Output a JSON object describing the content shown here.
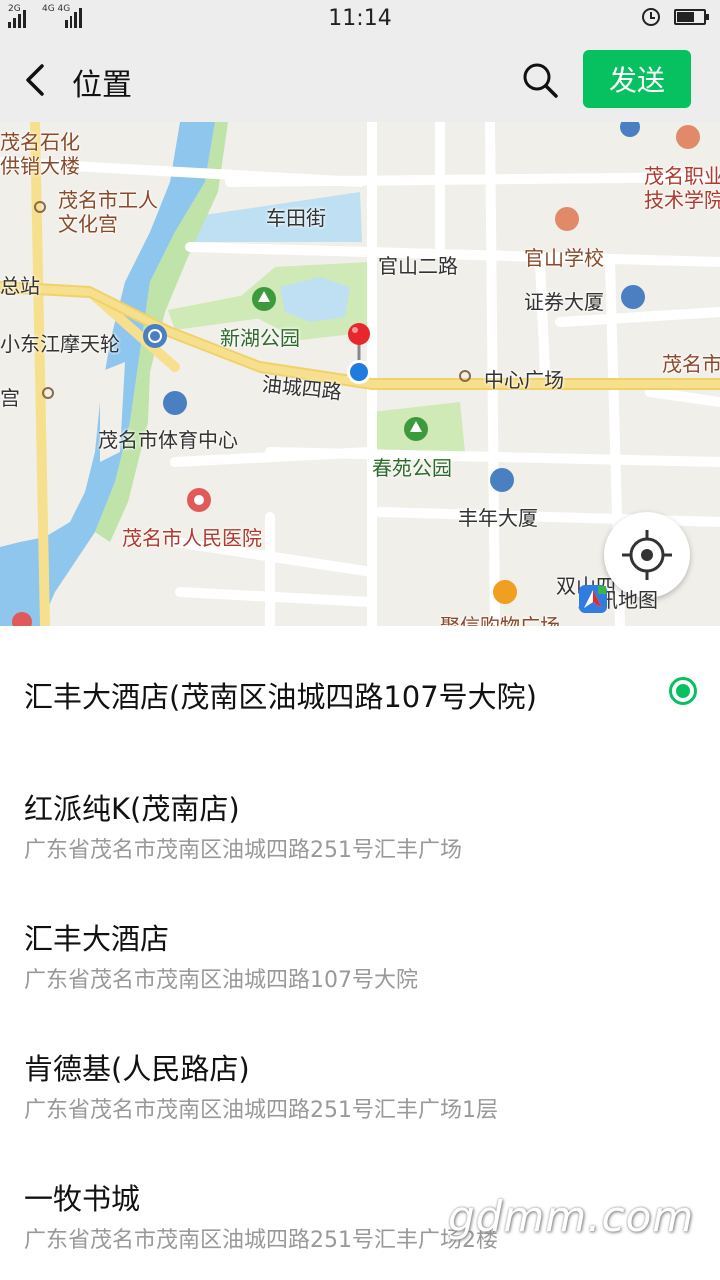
{
  "status_bar": {
    "signal1_label": "2G",
    "signal2_label": "4G 4G",
    "time": "11:14"
  },
  "header": {
    "title": "位置",
    "send_label": "发送"
  },
  "map": {
    "labels": {
      "maoming_shihua": "茂名石化",
      "gongxiao_dalou": "供销大楼",
      "gongren_wenhuagong": "茂名市工人",
      "gongren_wenhuagong2": "文化宫",
      "chetianjie": "车田街",
      "zhiye_jishu": "茂名职业",
      "zhiye_jishu2": "技术学院",
      "guanshan_erlu": "官山二路",
      "guanshan_xuexiao": "官山学校",
      "zongzhan": "总站",
      "zhengquan_dasha": "证券大厦",
      "xiaodongjiang": "小东江摩天轮",
      "xinhu_gongyuan": "新湖公园",
      "maoming_shi": "茂名市",
      "youcheng_silu": "油城四路",
      "zhongxin_guangchang": "中心广场",
      "gong": "宫",
      "tiyu_zhongxin": "茂名市体育中心",
      "chunyuan_gongyuan": "春苑公园",
      "fengnian_dasha": "丰年大厦",
      "renmin_yiyuan": "茂名市人民医院",
      "shuangshan": "双山四",
      "juxin_gouwu": "聚信购物广场"
    },
    "logo_text": "腾讯地图",
    "pin_color": "#e8262e",
    "location_dot_color": "#1e7be0"
  },
  "places": [
    {
      "name": "汇丰大酒店(茂南区油城四路107号大院)",
      "address": "",
      "selected": true
    },
    {
      "name": "红派纯K(茂南店)",
      "address": "广东省茂名市茂南区油城四路251号汇丰广场",
      "selected": false
    },
    {
      "name": "汇丰大酒店",
      "address": "广东省茂名市茂南区油城四路107号大院",
      "selected": false
    },
    {
      "name": "肯德基(人民路店)",
      "address": "广东省茂名市茂南区油城四路251号汇丰广场1层",
      "selected": false
    },
    {
      "name": "一牧书城",
      "address": "广东省茂名市茂南区油城四路251号汇丰广场2楼",
      "selected": false
    }
  ],
  "watermark": "gdmm.com",
  "colors": {
    "accent": "#07c160",
    "header_bg": "#ededed"
  }
}
